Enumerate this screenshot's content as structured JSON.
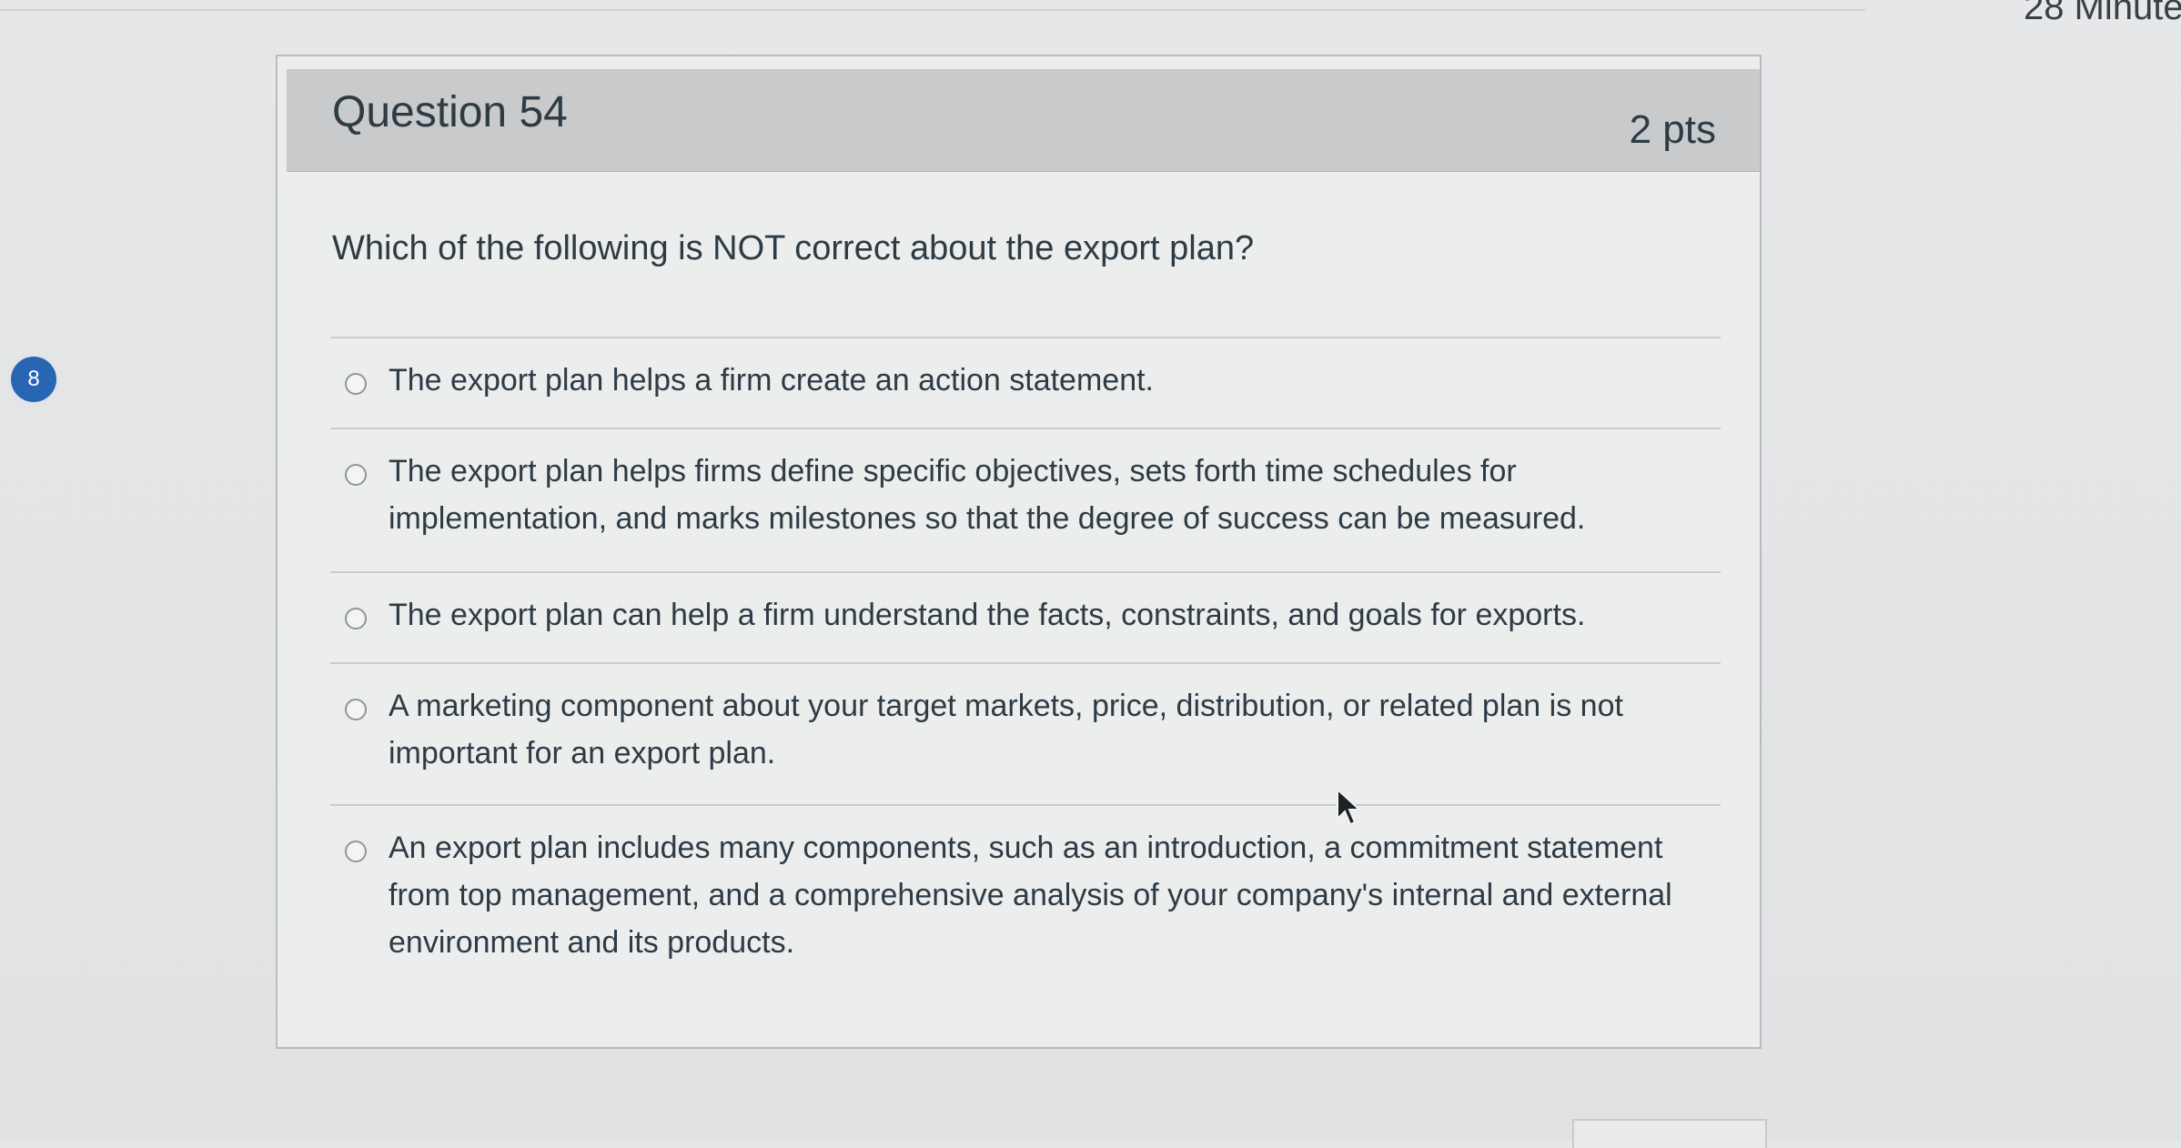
{
  "timer": {
    "label": "28 Minute"
  },
  "nav_badge": {
    "number": "8"
  },
  "question": {
    "title": "Question 54",
    "points": "2 pts",
    "text": "Which of the following is NOT correct about the export plan?",
    "answers": [
      {
        "label": "The export plan helps a firm create an action statement."
      },
      {
        "label": "The export plan helps firms define specific objectives, sets forth time schedules for implementation, and marks milestones so that the degree of success can be measured."
      },
      {
        "label": "The export plan can help a firm understand the facts, constraints, and goals for exports."
      },
      {
        "label": "A marketing component about your target markets, price, distribution, or related plan is not important for an export plan."
      },
      {
        "label": "An export plan includes many components, such as an introduction, a commitment statement from top management, and a comprehensive analysis of your company's internal and external environment and its products."
      }
    ]
  },
  "icons": {
    "radio": "radio-button-icon",
    "cursor": "mouse-pointer-icon",
    "badge": "question-number-badge"
  },
  "colors": {
    "badge": "#2866b4",
    "header": "#c8cacb",
    "text": "#2d3b45"
  }
}
